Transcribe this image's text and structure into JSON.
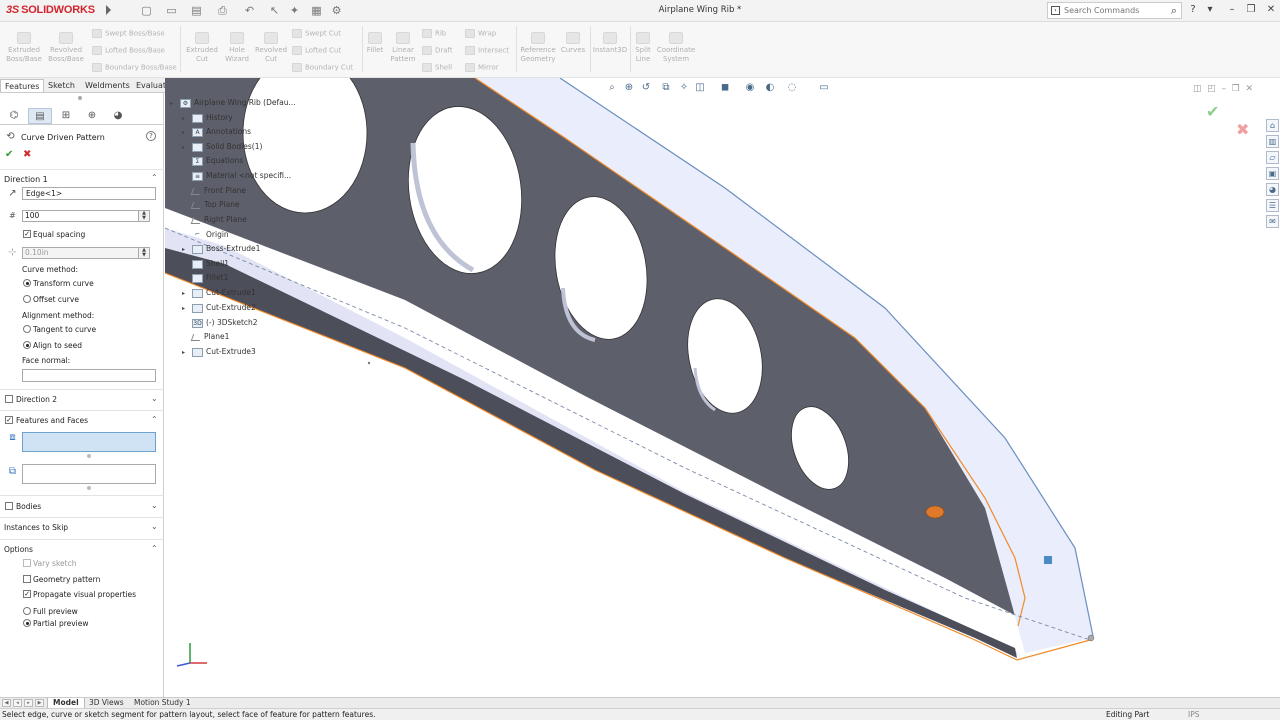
{
  "app": {
    "logo_ds": "3S",
    "logo_name": "SOLIDWORKS",
    "doc_title": "Airplane Wing Rib *"
  },
  "search": {
    "placeholder": "Search Commands"
  },
  "commands": {
    "extruded_boss": "Extruded Boss/Base",
    "revolved_boss": "Revolved Boss/Base",
    "swept_boss": "Swept Boss/Base",
    "lofted_boss": "Lofted Boss/Base",
    "boundary_boss": "Boundary Boss/Base",
    "extruded_cut": "Extruded Cut",
    "hole_wizard": "Hole Wizard",
    "revolved_cut": "Revolved Cut",
    "swept_cut": "Swept Cut",
    "lofted_cut": "Lofted Cut",
    "boundary_cut": "Boundary Cut",
    "fillet": "Fillet",
    "linear_pattern": "Linear Pattern",
    "rib": "Rib",
    "draft": "Draft",
    "shell": "Shell",
    "wrap": "Wrap",
    "intersect": "Intersect",
    "mirror": "Mirror",
    "reference_geometry": "Reference Geometry",
    "curves": "Curves",
    "instant3d": "Instant3D",
    "split_line": "Split Line",
    "coordinate_system": "Coordinate System"
  },
  "tabs": [
    "Features",
    "Sketch",
    "Weldments",
    "Evaluate"
  ],
  "property_manager": {
    "title": "Curve Driven Pattern",
    "direction1": {
      "label": "Direction 1",
      "edge": "Edge<1>",
      "instances": "100",
      "equal_spacing": "Equal spacing",
      "spacing": "0.10in",
      "curve_method_label": "Curve method:",
      "transform_curve": "Transform curve",
      "offset_curve": "Offset curve",
      "alignment_label": "Alignment method:",
      "tangent_to_curve": "Tangent to curve",
      "align_to_seed": "Align to seed",
      "face_normal_label": "Face normal:"
    },
    "direction2": "Direction 2",
    "features_and_faces": "Features and Faces",
    "bodies": "Bodies",
    "instances_to_skip": "Instances to Skip",
    "options": {
      "label": "Options",
      "vary_sketch": "Vary sketch",
      "geometry_pattern": "Geometry pattern",
      "propagate_visual": "Propagate visual properties",
      "full_preview": "Full preview",
      "partial_preview": "Partial preview"
    }
  },
  "tree": {
    "root": "Airplane Wing Rib  (Defau...",
    "items": [
      {
        "label": "History",
        "expand": true
      },
      {
        "label": "Annotations",
        "expand": true
      },
      {
        "label": "Solid Bodies(1)",
        "expand": true
      },
      {
        "label": "Equations",
        "expand": false
      },
      {
        "label": "Material <not specifi...",
        "expand": false
      },
      {
        "label": "Front Plane",
        "expand": false
      },
      {
        "label": "Top Plane",
        "expand": false
      },
      {
        "label": "Right Plane",
        "expand": false
      },
      {
        "label": "Origin",
        "expand": false
      },
      {
        "label": "Boss-Extrude1",
        "expand": true
      },
      {
        "label": "Shell1",
        "expand": false
      },
      {
        "label": "Fillet1",
        "expand": false
      },
      {
        "label": "Cut-Extrude1",
        "expand": true
      },
      {
        "label": "Cut-Extrude2",
        "expand": true
      },
      {
        "label": "(-) 3DSketch2",
        "expand": false
      },
      {
        "label": "Plane1",
        "expand": false
      },
      {
        "label": "Cut-Extrude3",
        "expand": true
      }
    ]
  },
  "bottom_tabs": [
    "Model",
    "3D Views",
    "Motion Study 1"
  ],
  "status": {
    "message": "Select edge, curve or sketch segment for pattern layout, select face of feature for pattern features.",
    "mode": "Editing Part",
    "units": "IPS"
  },
  "colors": {
    "accent": "#d2252d",
    "model_face": "#5a5c6a",
    "model_light": "#e9ecfa",
    "edge": "#f08a2a"
  }
}
